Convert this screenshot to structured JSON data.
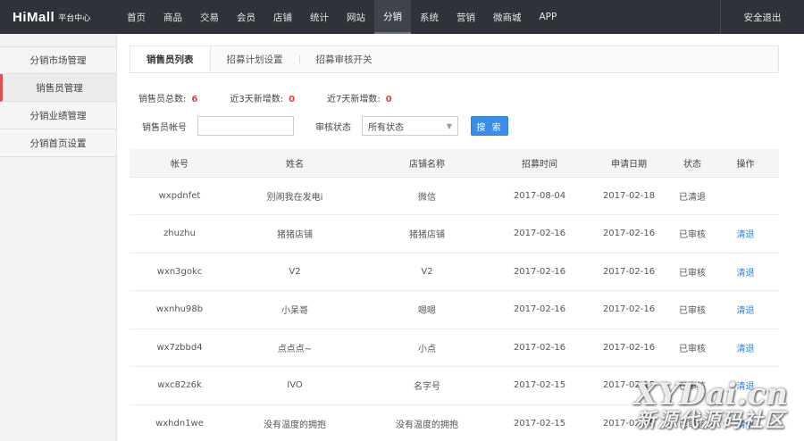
{
  "topbar": {
    "brand": "HiMall",
    "subtitle": "平台中心",
    "nav": [
      "首页",
      "商品",
      "交易",
      "会员",
      "店铺",
      "统计",
      "网站",
      "分销",
      "系统",
      "营销",
      "微商城",
      "APP"
    ],
    "active_nav": "分销",
    "logout": "安全退出"
  },
  "sidebar": {
    "items": [
      "分销市场管理",
      "销售员管理",
      "分销业绩管理",
      "分销首页设置"
    ],
    "active": "销售员管理"
  },
  "tabs": [
    "销售员列表",
    "招募计划设置",
    "招募审核开关"
  ],
  "stats": {
    "total_label": "销售员总数:",
    "total": "6",
    "recent3_label": "近3天新增数:",
    "recent3": "0",
    "recent7_label": "近7天新增数:",
    "recent7": "0"
  },
  "filters": {
    "account_label": "销售员帐号",
    "account_value": "",
    "status_label": "审核状态",
    "status_value": "所有状态",
    "search_button": "搜 索"
  },
  "table": {
    "headers": [
      "帐号",
      "姓名",
      "店铺名称",
      "招募时间",
      "申请日期",
      "状态",
      "操作"
    ],
    "rows": [
      [
        "wxpdnfet",
        "别闹我在发电i",
        "微信",
        "2017-08-04",
        "2017-02-18",
        "已清退",
        ""
      ],
      [
        "zhuzhu",
        "猪猪店铺",
        "猪猪店铺",
        "2017-02-16",
        "2017-02-16",
        "已审核",
        "清退"
      ],
      [
        "wxn3gokc",
        "V2",
        "V2",
        "2017-02-16",
        "2017-02-16",
        "已审核",
        "清退"
      ],
      [
        "wxnhu98b",
        "小呆哥",
        "嗯嗯",
        "2017-02-16",
        "2017-02-16",
        "已审核",
        "清退"
      ],
      [
        "wx7zbbd4",
        "点点点~",
        "小点",
        "2017-02-16",
        "2017-02-16",
        "已审核",
        "清退"
      ],
      [
        "wxc82z6k",
        "IVO",
        "名字号",
        "2017-02-15",
        "2017-02-15",
        "已审核",
        "清退"
      ],
      [
        "wxhdn1we",
        "没有温度的拥抱",
        "没有温度的拥抱",
        "2017-02-15",
        "2017-02-15",
        "已审核",
        "清退"
      ]
    ]
  },
  "watermark": {
    "line1": "XYDai.cn",
    "line2": "新源代源码社区"
  }
}
